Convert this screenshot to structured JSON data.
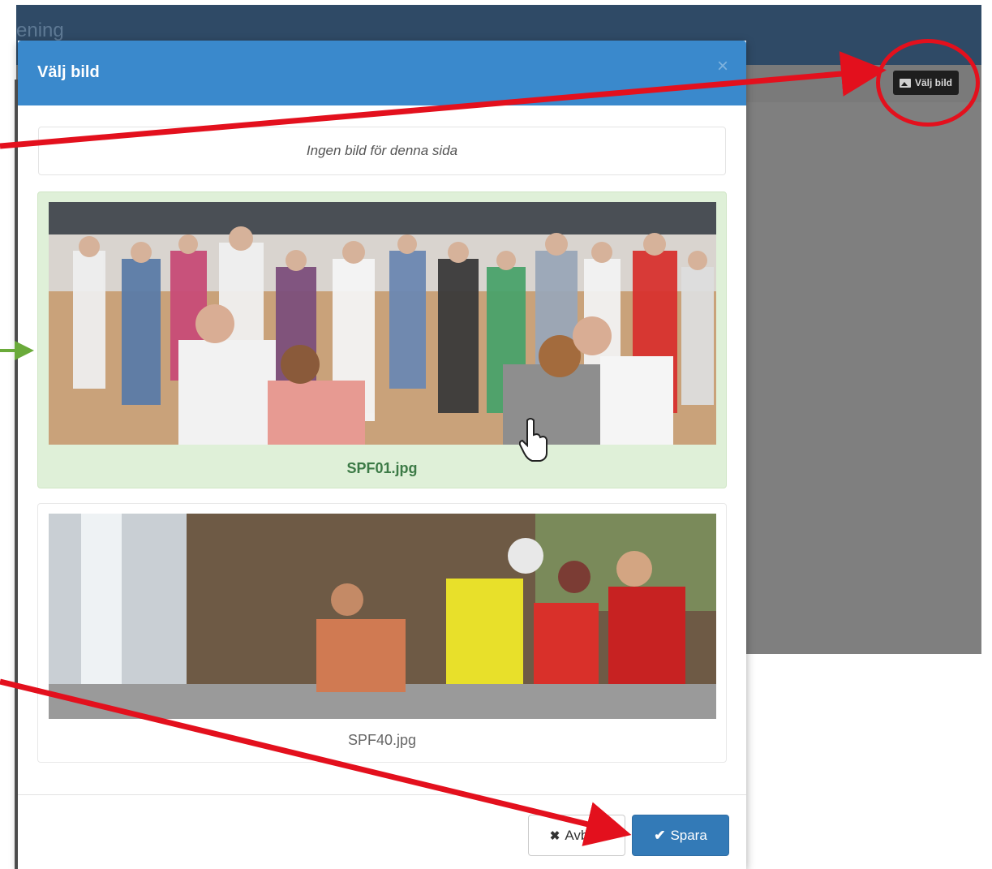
{
  "app": {
    "title_fragment": "ening",
    "choose_image_label": "Välj bild"
  },
  "modal": {
    "title": "Välj bild",
    "close": "×",
    "no_image_text": "Ingen bild för denna sida",
    "images": [
      {
        "filename": "SPF01.jpg",
        "selected": true,
        "icon": "dancing-crowd-photo"
      },
      {
        "filename": "SPF40.jpg",
        "selected": false,
        "icon": "waterfall-hikers-photo"
      }
    ],
    "footer": {
      "cancel_label": "Avbryt",
      "save_label": "Spara"
    }
  },
  "colors": {
    "header": "#3a89cc",
    "app_header": "#2f4a66",
    "selected_card": "#dff0d8",
    "save_button": "#337ab7",
    "annotation_red": "#e3101d",
    "annotation_green": "#6aaa3a"
  },
  "icons": {
    "choose_image_button": "image-icon",
    "cancel": "close-icon",
    "save": "check-icon",
    "cursor": "hand-pointer-icon"
  }
}
